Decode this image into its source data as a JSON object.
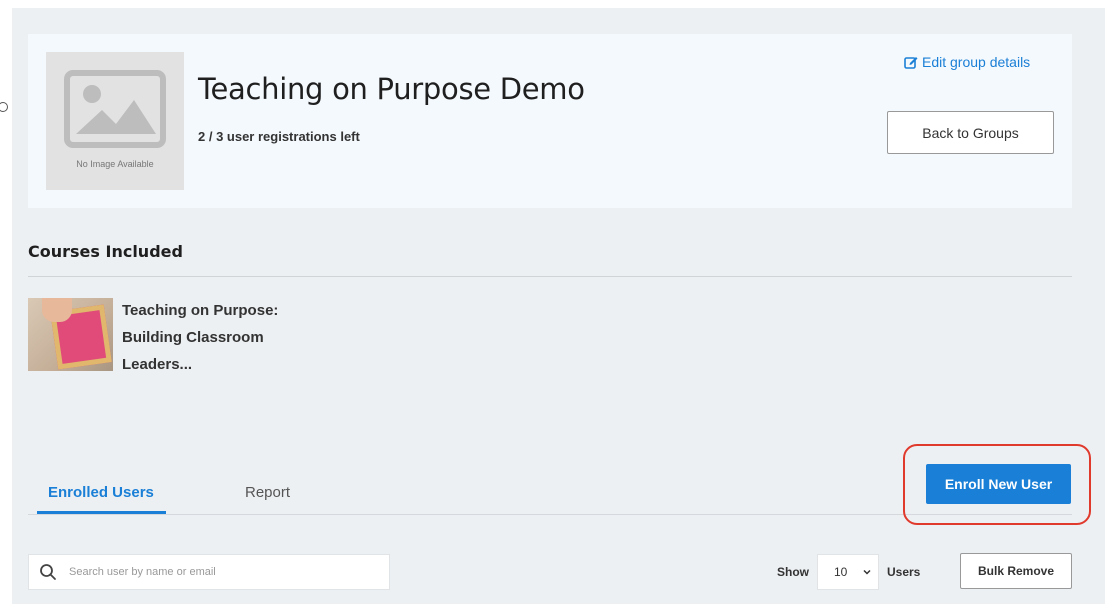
{
  "group": {
    "title": "Teaching on Purpose Demo",
    "registrations": "2 / 3 user registrations left",
    "no_image_text": "No Image Available",
    "edit_link": "Edit group details",
    "back_button": "Back to Groups"
  },
  "courses": {
    "heading": "Courses Included",
    "items": [
      {
        "title": "Teaching on Purpose: Building Classroom Leaders..."
      }
    ]
  },
  "tabs": [
    {
      "label": "Enrolled Users",
      "active": true
    },
    {
      "label": "Report",
      "active": false
    }
  ],
  "actions": {
    "enroll_button": "Enroll New User",
    "bulk_remove": "Bulk Remove"
  },
  "search": {
    "placeholder": "Search user by name or email",
    "value": ""
  },
  "pagination": {
    "show_label": "Show",
    "page_size": "10",
    "users_label": "Users"
  },
  "colors": {
    "accent": "#1a7fd6",
    "highlight": "#e03a2d",
    "panel": "#edf0f3",
    "card": "#f4f9fd"
  },
  "icons": {
    "edit": "edit-icon",
    "search": "search-icon",
    "chevron": "chevron-down-icon",
    "placeholder_image": "image-placeholder-icon"
  }
}
